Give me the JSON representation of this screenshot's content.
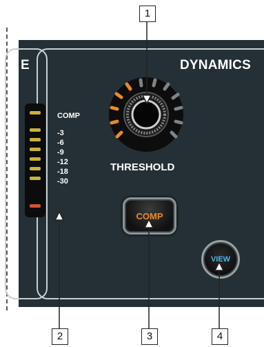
{
  "panel": {
    "left_section_label": "E",
    "dynamics_label": "DYNAMICS",
    "threshold_label": "THRESHOLD",
    "meter": {
      "labels": [
        "COMP",
        "-3",
        "-6",
        "-9",
        "-12",
        "-18",
        "-30"
      ]
    },
    "comp_button_label": "COMP",
    "view_button_label": "VIEW"
  },
  "callouts": [
    "1",
    "2",
    "3",
    "4"
  ],
  "colors": {
    "panel_bg": "#243035",
    "led_yellow": "#c9b23a",
    "led_red": "#d0552e",
    "comp_orange": "#e88b2a",
    "view_blue": "#4fb3e8"
  }
}
